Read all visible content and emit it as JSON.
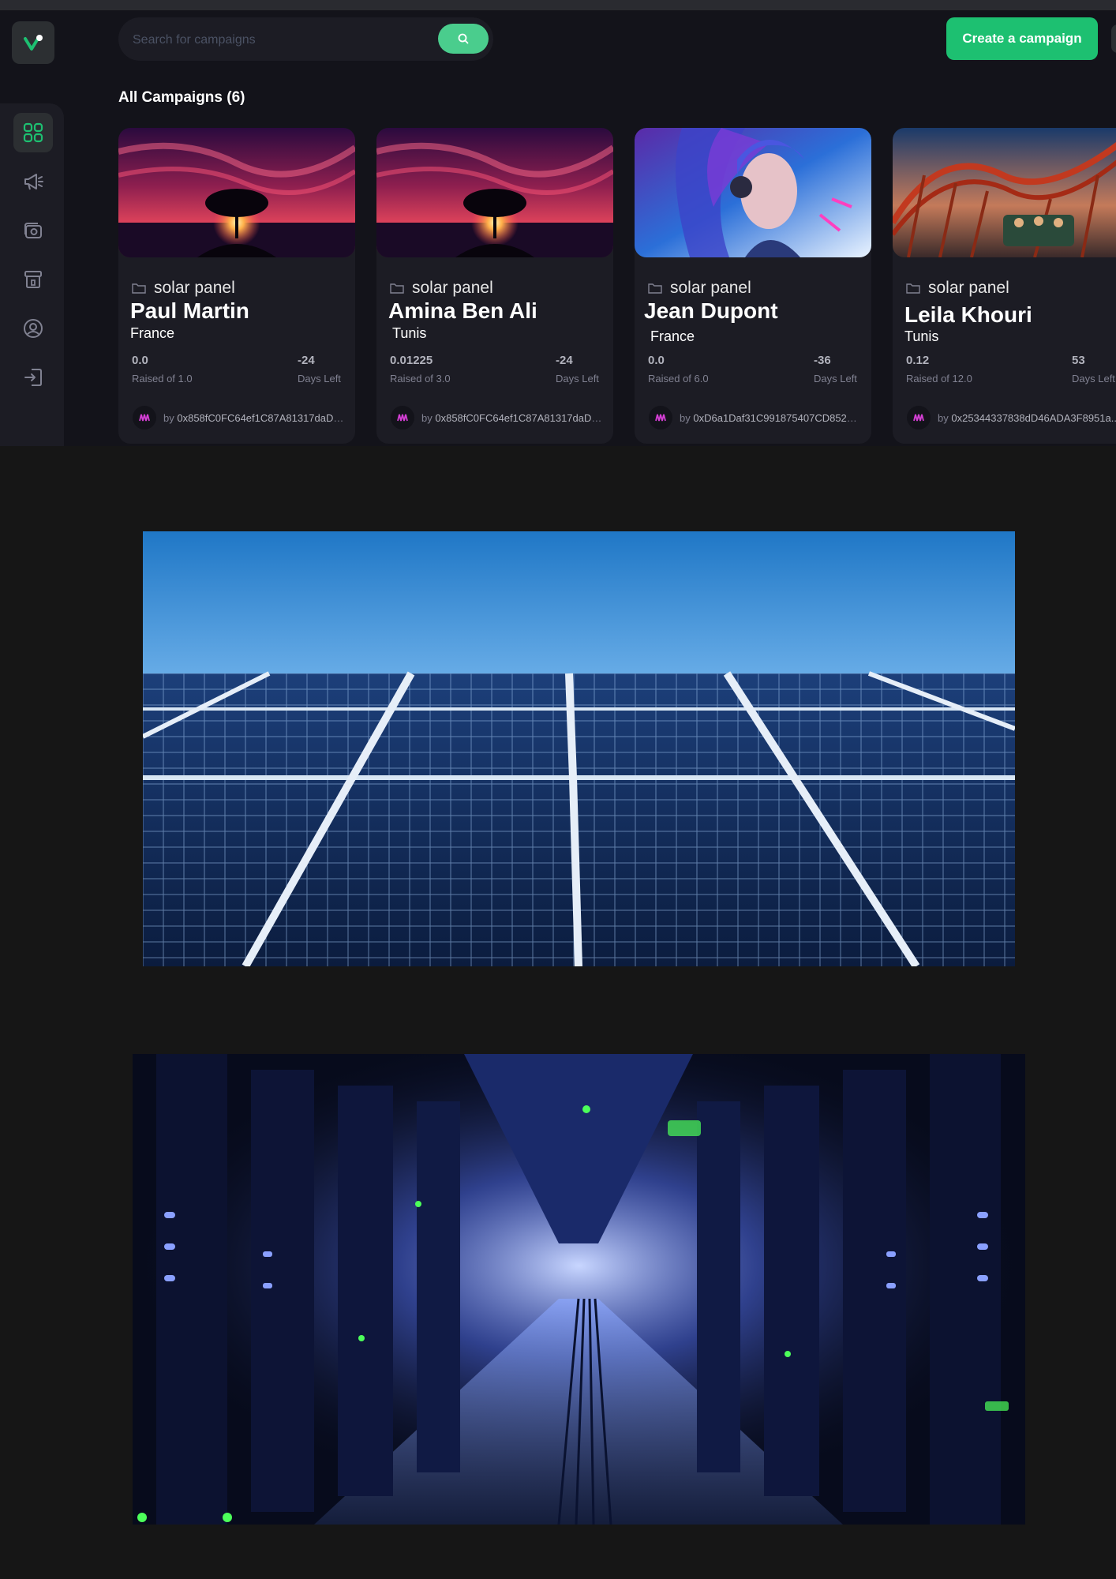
{
  "search": {
    "placeholder": "Search for campaigns"
  },
  "header": {
    "create_label": "Create a campaign"
  },
  "section": {
    "title": "All Campaigns (6)"
  },
  "sidebar": {
    "items": [
      {
        "icon": "dashboard-icon",
        "active": true
      },
      {
        "icon": "campaign-icon",
        "active": false
      },
      {
        "icon": "payment-icon",
        "active": false
      },
      {
        "icon": "withdraw-icon",
        "active": false
      },
      {
        "icon": "profile-icon",
        "active": false
      },
      {
        "icon": "logout-icon",
        "active": false
      }
    ]
  },
  "campaigns": [
    {
      "category": "solar panel",
      "name": "Paul Martin",
      "country": "France",
      "raised": "0.0",
      "raised_label": "Raised of 1.0",
      "days": "-24",
      "days_label": "Days Left",
      "by": "by",
      "owner": "0x858fC0FC64ef1C87A81317daDF..."
    },
    {
      "category": "solar panel",
      "name": "Amina Ben Ali",
      "country": "Tunis",
      "raised": "0.01225",
      "raised_label": "Raised of 3.0",
      "days": "-24",
      "days_label": "Days Left",
      "by": "by",
      "owner": "0x858fC0FC64ef1C87A81317daDF..."
    },
    {
      "category": "solar panel",
      "name": "Jean Dupont",
      "country": "France",
      "raised": "0.0",
      "raised_label": "Raised of 6.0",
      "days": "-36",
      "days_label": "Days Left",
      "by": "by",
      "owner": "0xD6a1Daf31C991875407CD8525a..."
    },
    {
      "category": "solar panel",
      "name": "Leila Khouri",
      "country": "Tunis",
      "raised": "0.12",
      "raised_label": "Raised of 12.0",
      "days": "53",
      "days_label": "Days Left",
      "by": "by",
      "owner": "0x25344337838dD46ADA3F8951a..."
    }
  ],
  "colors": {
    "accent": "#1dc071",
    "search_btn": "#4acd8d",
    "card_bg": "#1c1c24",
    "page_bg": "#13131a"
  }
}
